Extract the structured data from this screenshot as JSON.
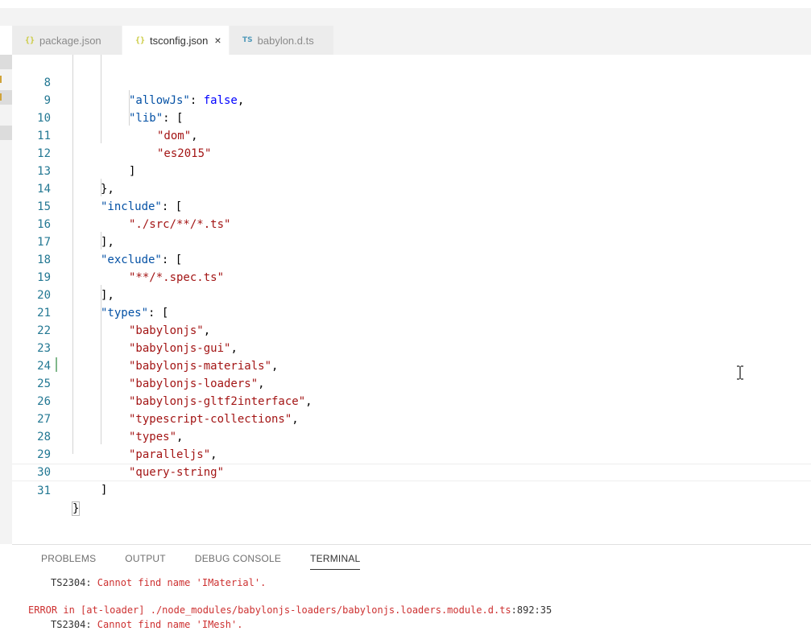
{
  "tabs": [
    {
      "icon": "{}",
      "label": "package.json",
      "active": false
    },
    {
      "icon": "{}",
      "label": "tsconfig.json",
      "active": true,
      "close": "×"
    },
    {
      "icon": "TS",
      "label": "babylon.d.ts",
      "active": false
    }
  ],
  "editor": {
    "lines": [
      {
        "n": "8"
      },
      {
        "n": "9"
      },
      {
        "n": "10"
      },
      {
        "n": "11"
      },
      {
        "n": "12"
      },
      {
        "n": "13"
      },
      {
        "n": "14"
      },
      {
        "n": "15"
      },
      {
        "n": "16"
      },
      {
        "n": "17"
      },
      {
        "n": "18"
      },
      {
        "n": "19"
      },
      {
        "n": "20"
      },
      {
        "n": "21"
      },
      {
        "n": "22"
      },
      {
        "n": "23"
      },
      {
        "n": "24"
      },
      {
        "n": "25"
      },
      {
        "n": "26"
      },
      {
        "n": "27"
      },
      {
        "n": "28"
      },
      {
        "n": "29"
      },
      {
        "n": "30"
      },
      {
        "n": "31"
      }
    ],
    "tokens": {
      "allowJs_key": "\"allowJs\"",
      "false": "false",
      "lib_key": "\"lib\"",
      "dom": "\"dom\"",
      "es2015": "\"es2015\"",
      "include_key": "\"include\"",
      "src_glob": "\"./src/**/*.ts\"",
      "exclude_key": "\"exclude\"",
      "spec_glob": "\"**/*.spec.ts\"",
      "types_key": "\"types\"",
      "types_values": [
        "\"babylonjs\"",
        "\"babylonjs-gui\"",
        "\"babylonjs-materials\"",
        "\"babylonjs-loaders\"",
        "\"babylonjs-gltf2interface\"",
        "\"typescript-collections\"",
        "\"types\"",
        "\"paralleljs\"",
        "\"query-string\""
      ]
    }
  },
  "panel": {
    "tabs": [
      "PROBLEMS",
      "OUTPUT",
      "DEBUG CONSOLE",
      "TERMINAL"
    ],
    "active_tab": "TERMINAL",
    "terminal": {
      "line1_code": "TS2304:",
      "line1_msg": " Cannot find name 'IMaterial'.",
      "line2_prefix": "ERROR in [at-loader] ./node_modules/babylonjs-loaders/babylonjs.loaders.module.d.ts",
      "line2_pos": ":892:35",
      "line3_code": "TS2304:",
      "line3_msg": " Cannot find name 'IMesh'."
    }
  },
  "colors": {
    "line_number": "#237893",
    "string": "#a31515",
    "keyword": "#0000ff",
    "error": "#cd3131",
    "modified_gutter": "#81b88b"
  }
}
